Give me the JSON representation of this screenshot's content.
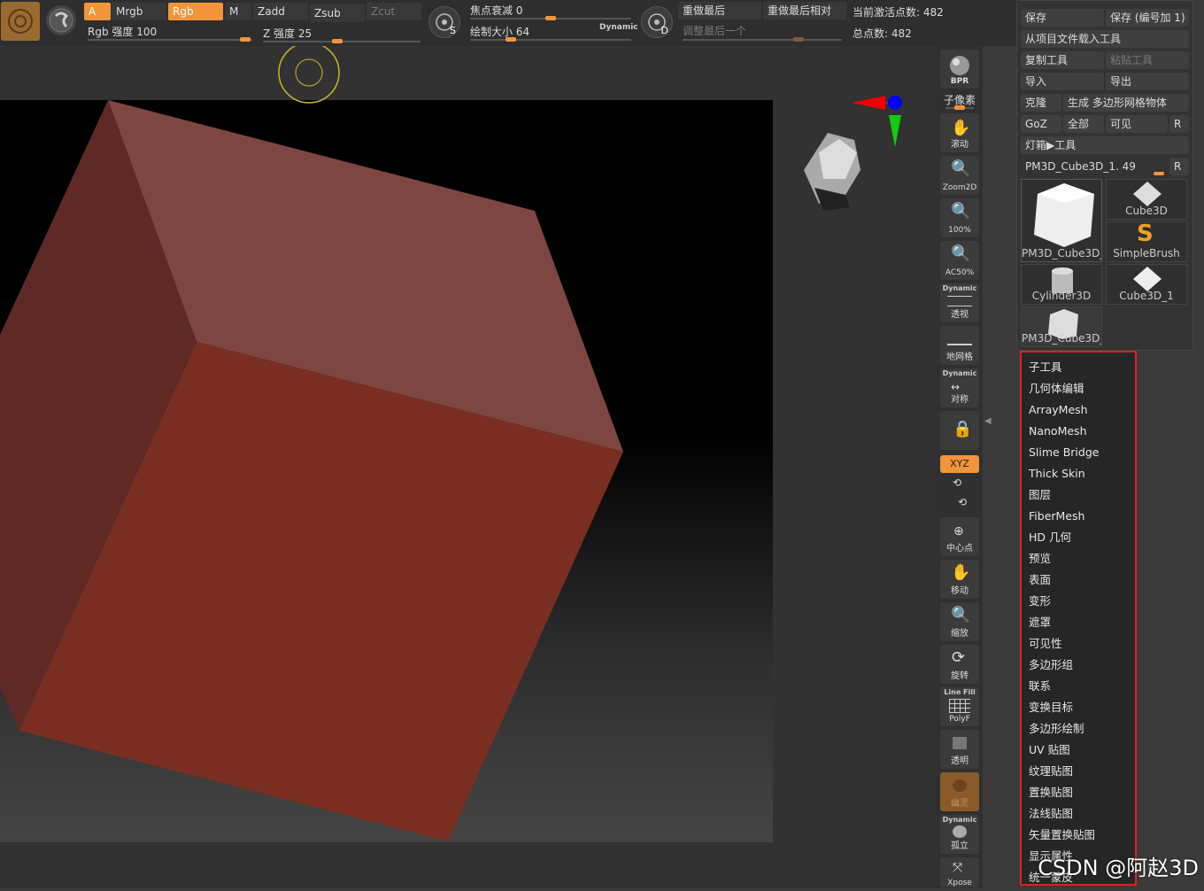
{
  "toolbar": {
    "a": "A",
    "mrgb": "Mrgb",
    "rgb": "Rgb",
    "m": "M",
    "zadd": "Zadd",
    "zsub": "Zsub",
    "zcut": "Zcut",
    "rgb_intensity": "Rgb 强度 100",
    "z_intensity": "Z 强度 25",
    "focal_shift": "焦点衰减 0",
    "draw_size": "绘制大小 64",
    "dynamic": "Dynamic",
    "redo_last": "重做最后",
    "redo_last_relative": "重做最后相对",
    "adjust_last": "调整最后一个",
    "active_points": "当前激活点数: 482",
    "total_points": "总点数: 482",
    "s_label": "S",
    "d_label": "D"
  },
  "shelf": {
    "bpr": "BPR",
    "subpixel": "子像素",
    "scroll": "滚动",
    "zoom2d": "Zoom2D",
    "zoom100": "100%",
    "ac50": "AC50%",
    "dynamic": "Dynamic",
    "perspective": "透视",
    "floor": "地网格",
    "symmetry": "对称",
    "xyz": "XYZ",
    "center": "中心点",
    "move": "移动",
    "scale": "缩放",
    "rotate": "旋转",
    "linefill": "Line Fill",
    "polyf": "PolyF",
    "transparent": "透明",
    "ghost": "幽灵",
    "solo": "孤立",
    "xpose": "Xpose"
  },
  "panel": {
    "save": "保存",
    "save_inc": "保存 (编号加 1)",
    "load_from_project": "从项目文件载入工具",
    "copy_tool": "复制工具",
    "paste_tool": "粘贴工具",
    "import": "导入",
    "export": "导出",
    "clone": "克隆",
    "make_polymesh": "生成 多边形网格物体",
    "goz": "GoZ",
    "all": "全部",
    "visible": "可见",
    "r": "R",
    "lightbox_tools": "灯箱▶工具",
    "current_tool": "PM3D_Cube3D_1. 49",
    "thumbs": [
      "PM3D_Cube3D_",
      "Cube3D",
      "SimpleBrush",
      "Cylinder3D",
      "Cube3D_1",
      "PM3D_Cube3D_"
    ]
  },
  "menu": {
    "items": [
      "子工具",
      "几何体编辑",
      "ArrayMesh",
      "NanoMesh",
      "Slime Bridge",
      "Thick Skin",
      "图层",
      "FiberMesh",
      "HD 几何",
      "预览",
      "表面",
      "变形",
      "遮罩",
      "可见性",
      "多边形组",
      "联系",
      "变换目标",
      "多边形绘制",
      "UV 贴图",
      "纹理贴图",
      "置换贴图",
      "法线贴图",
      "矢量置换贴图",
      "显示属性",
      "统一蒙皮"
    ]
  },
  "watermark": "CSDN @阿赵3D",
  "colors": {
    "accent": "#f2953a",
    "highlight_border": "#e02020",
    "cube_front": "#7a2e22",
    "cube_top": "#7e4640",
    "cube_side": "#5f2a25"
  }
}
